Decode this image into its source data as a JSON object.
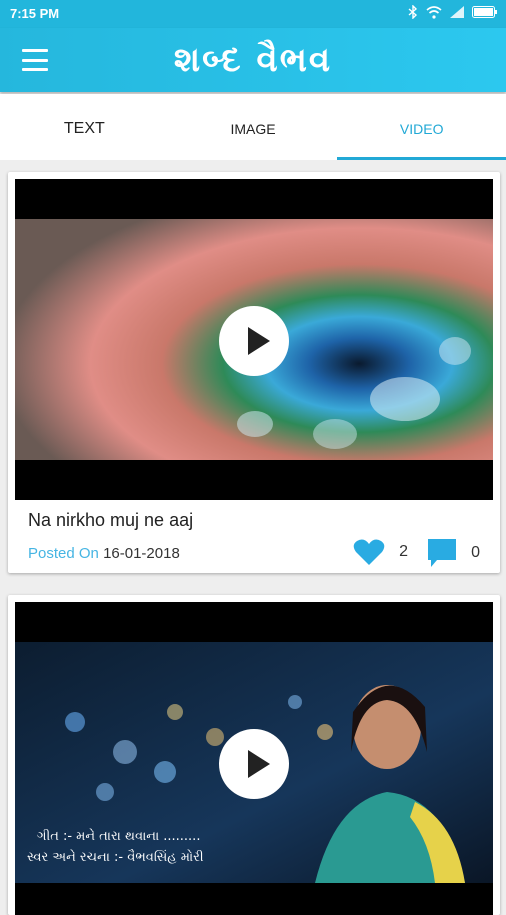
{
  "status_bar": {
    "time": "7:15 PM"
  },
  "app_bar": {
    "title": "શબ્દ વૈભવ"
  },
  "tabs": [
    {
      "label": "TEXT"
    },
    {
      "label": "IMAGE"
    },
    {
      "label": "VIDEO"
    }
  ],
  "active_tab": "VIDEO",
  "videos": [
    {
      "title": "Na nirkho muj ne aaj",
      "posted_label": "Posted On",
      "date": "16-01-2018",
      "likes": "2",
      "comments": "0"
    },
    {
      "overlay_line1": "ગીત :- મને તારા થવાના .........",
      "overlay_line2": "સ્વર અને રચના :- વૈભવસિંહ મોરી"
    }
  ],
  "colors": {
    "accent": "#22a9d6",
    "appbar": "#25b7dd"
  },
  "icons": [
    "wifi-icon",
    "bluetooth-icon",
    "signal-icon",
    "battery-icon",
    "menu-icon",
    "play-icon",
    "heart-icon",
    "comment-icon"
  ]
}
